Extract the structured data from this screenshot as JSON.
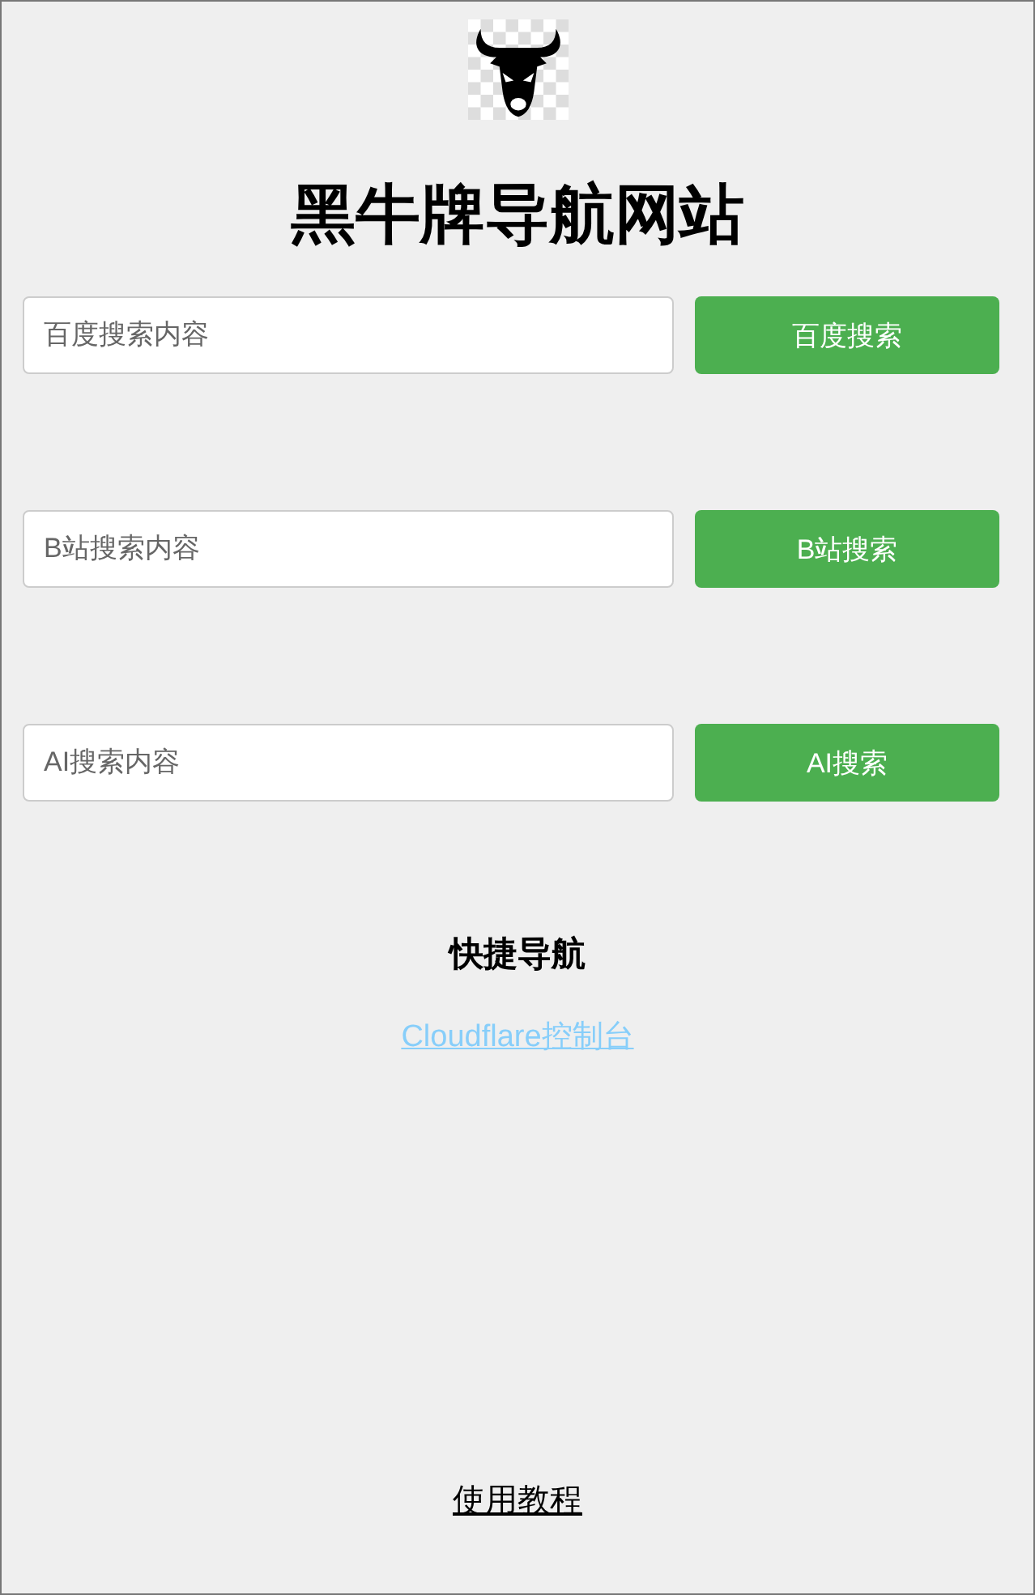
{
  "title": "黑牛牌导航网站",
  "searches": [
    {
      "placeholder": "百度搜索内容",
      "button": "百度搜索"
    },
    {
      "placeholder": "B站搜索内容",
      "button": "B站搜索"
    },
    {
      "placeholder": "AI搜索内容",
      "button": "AI搜索"
    }
  ],
  "quick_nav": {
    "heading": "快捷导航",
    "links": [
      "Cloudflare控制台"
    ]
  },
  "footer_link": "使用教程"
}
